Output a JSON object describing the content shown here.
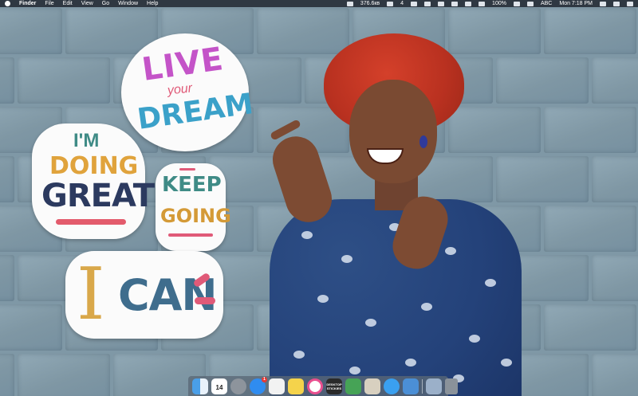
{
  "menubar": {
    "items": [
      "Finder",
      "File",
      "Edit",
      "View",
      "Go",
      "Window",
      "Help"
    ],
    "status": {
      "network_rate": "376.6кв",
      "indicator_count": "4",
      "battery": "100%",
      "keyboard": "ABC",
      "clock": "Mon 7:18 PM"
    }
  },
  "stickers": {
    "live": [
      "LIVE",
      "your",
      "DREAM"
    ],
    "doing": [
      "I'M",
      "DOING",
      "GREAT"
    ],
    "keep": [
      "KEEP",
      "GOING"
    ],
    "ican": [
      "I",
      "CAN"
    ]
  },
  "dock": {
    "items": [
      {
        "name": "finder",
        "color": "#4a9fe8"
      },
      {
        "name": "calendar",
        "label": "14",
        "color": "#ffffff"
      },
      {
        "name": "launchpad",
        "color": "#8d949c"
      },
      {
        "name": "app-store",
        "badge": "1",
        "color": "#2f8cf0"
      },
      {
        "name": "text-document",
        "color": "#f2f2f2"
      },
      {
        "name": "notes",
        "color": "#f5d34b"
      },
      {
        "name": "itunes",
        "color": "#e94f8f"
      },
      {
        "name": "desktop-stickies",
        "label": "DESKTOP\nSTICKIES",
        "color": "#2a2a2a"
      },
      {
        "name": "battery-app",
        "color": "#46a356"
      },
      {
        "name": "preview-app",
        "color": "#d8d0c0"
      },
      {
        "name": "safari",
        "color": "#3aa0f0"
      },
      {
        "name": "xcode",
        "color": "#4b8fd6"
      },
      {
        "name": "photos",
        "color": "#9bb0c9"
      },
      {
        "name": "trash",
        "color": "#8a929a"
      }
    ]
  }
}
